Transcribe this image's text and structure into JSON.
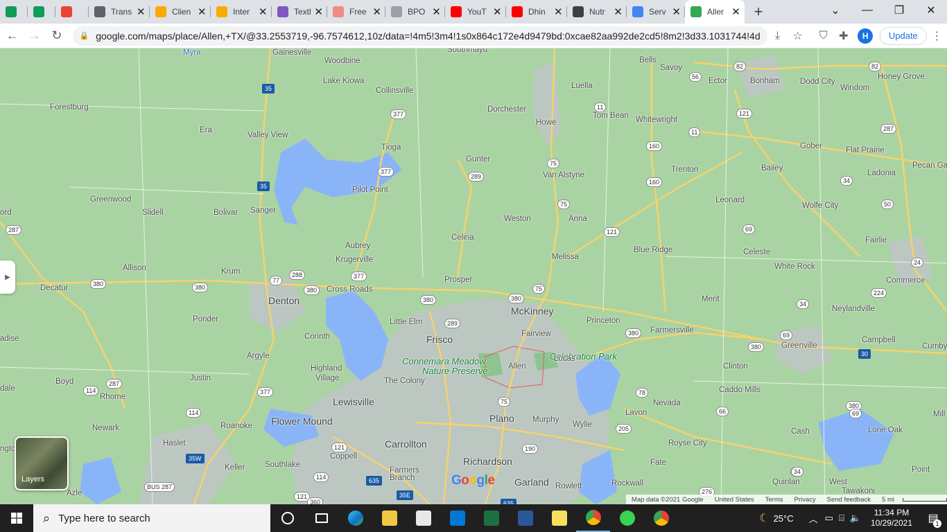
{
  "browser": {
    "tabs": [
      {
        "title": "",
        "icon": "sheets-icon",
        "color": "#0f9d58"
      },
      {
        "title": "",
        "icon": "sheets-icon",
        "color": "#0f9d58"
      },
      {
        "title": "",
        "icon": "gmail-icon",
        "color": "#ea4335"
      },
      {
        "title": "Trans",
        "icon": "globe-icon",
        "color": "#5f6368"
      },
      {
        "title": "Clien",
        "icon": "emoji-icon",
        "color": "#f9ab00"
      },
      {
        "title": "Inter",
        "icon": "emoji-icon",
        "color": "#f9ab00"
      },
      {
        "title": "Textl",
        "icon": "textnow-icon",
        "color": "#7e57c2"
      },
      {
        "title": "Free",
        "icon": "x-logo-icon",
        "color": "#f28b82"
      },
      {
        "title": "BPO",
        "icon": "page-icon",
        "color": "#9aa0a6"
      },
      {
        "title": "YouT",
        "icon": "youtube-icon",
        "color": "#ff0000"
      },
      {
        "title": "Dhin",
        "icon": "youtube-icon",
        "color": "#ff0000"
      },
      {
        "title": "Nutr",
        "icon": "cube-icon",
        "color": "#3c4043"
      },
      {
        "title": "Serv",
        "icon": "google-icon",
        "color": "#4285f4"
      },
      {
        "title": "Aller",
        "icon": "maps-pin-icon",
        "color": "#34a853",
        "active": true
      }
    ],
    "url": "google.com/maps/place/Allen,+TX/@33.2553719,-96.7574612,10z/data=!4m5!3m4!1s0x864c172e4d9479bd:0xcae82aa992de2cd5!8m2!3d33.1031744!4d-...",
    "profile_initial": "H",
    "update_label": "Update"
  },
  "map": {
    "places": [
      {
        "name": "Myra",
        "kind": "water"
      },
      {
        "name": "Gainesville",
        "kind": "town"
      },
      {
        "name": "Southmayd",
        "kind": "town"
      },
      {
        "name": "Woodbine",
        "kind": "town"
      },
      {
        "name": "Lake Kiowa",
        "kind": "town"
      },
      {
        "name": "Collinsville",
        "kind": "town"
      },
      {
        "name": "Forestburg",
        "kind": "town"
      },
      {
        "name": "Era",
        "kind": "town"
      },
      {
        "name": "Valley View",
        "kind": "town"
      },
      {
        "name": "Tioga",
        "kind": "town"
      },
      {
        "name": "Dorchester",
        "kind": "town"
      },
      {
        "name": "Howe",
        "kind": "town"
      },
      {
        "name": "Luella",
        "kind": "town"
      },
      {
        "name": "Bells",
        "kind": "town"
      },
      {
        "name": "Savoy",
        "kind": "town"
      },
      {
        "name": "Ector",
        "kind": "town"
      },
      {
        "name": "Bonham",
        "kind": "town"
      },
      {
        "name": "Dodd City",
        "kind": "town"
      },
      {
        "name": "Windom",
        "kind": "town"
      },
      {
        "name": "Honey Grove",
        "kind": "town"
      },
      {
        "name": "Tom Bean",
        "kind": "town"
      },
      {
        "name": "Whitewright",
        "kind": "town"
      },
      {
        "name": "Gober",
        "kind": "town"
      },
      {
        "name": "Flat Prairie",
        "kind": "town"
      },
      {
        "name": "Pecan Ga",
        "kind": "town"
      },
      {
        "name": "Gunter",
        "kind": "town"
      },
      {
        "name": "Van Alstyne",
        "kind": "town"
      },
      {
        "name": "Trenton",
        "kind": "town"
      },
      {
        "name": "Bailey",
        "kind": "town"
      },
      {
        "name": "Ladonia",
        "kind": "town"
      },
      {
        "name": "Greenwood",
        "kind": "town"
      },
      {
        "name": "Slidell",
        "kind": "town"
      },
      {
        "name": "Bolivar",
        "kind": "town"
      },
      {
        "name": "Sanger",
        "kind": "town"
      },
      {
        "name": "Pilot Point",
        "kind": "town"
      },
      {
        "name": "Leonard",
        "kind": "town"
      },
      {
        "name": "Wolfe City",
        "kind": "town"
      },
      {
        "name": "ord",
        "kind": "town"
      },
      {
        "name": "Weston",
        "kind": "town"
      },
      {
        "name": "Anna",
        "kind": "town"
      },
      {
        "name": "Celina",
        "kind": "town"
      },
      {
        "name": "Aubrey",
        "kind": "town"
      },
      {
        "name": "Krugerville",
        "kind": "town"
      },
      {
        "name": "Blue Ridge",
        "kind": "town"
      },
      {
        "name": "Celeste",
        "kind": "town"
      },
      {
        "name": "Fairlie",
        "kind": "town"
      },
      {
        "name": "Melissa",
        "kind": "town"
      },
      {
        "name": "Allison",
        "kind": "town"
      },
      {
        "name": "Krum",
        "kind": "town"
      },
      {
        "name": "White Rock",
        "kind": "town"
      },
      {
        "name": "Decatur",
        "kind": "town"
      },
      {
        "name": "Prosper",
        "kind": "town"
      },
      {
        "name": "Cross Roads",
        "kind": "town"
      },
      {
        "name": "Commerce",
        "kind": "town"
      },
      {
        "name": "Denton",
        "kind": "city"
      },
      {
        "name": "McKinney",
        "kind": "city"
      },
      {
        "name": "Merit",
        "kind": "town"
      },
      {
        "name": "Neylandville",
        "kind": "town"
      },
      {
        "name": "Ponder",
        "kind": "town"
      },
      {
        "name": "Little Elm",
        "kind": "town"
      },
      {
        "name": "Princeton",
        "kind": "town"
      },
      {
        "name": "Farmersville",
        "kind": "town"
      },
      {
        "name": "Fairview",
        "kind": "town"
      },
      {
        "name": "Greenville",
        "kind": "town"
      },
      {
        "name": "Frisco",
        "kind": "city"
      },
      {
        "name": "Corinth",
        "kind": "town"
      },
      {
        "name": "Campbell",
        "kind": "town"
      },
      {
        "name": "Cumby",
        "kind": "town"
      },
      {
        "name": "adise",
        "kind": "town"
      },
      {
        "name": "Argyle",
        "kind": "town"
      },
      {
        "name": "Celebration Park",
        "kind": "park"
      },
      {
        "name": "Connemara Meadow",
        "kind": "park"
      },
      {
        "name": "Nature Preserve",
        "kind": "park"
      },
      {
        "name": "Allen",
        "kind": "town"
      },
      {
        "name": "Highland",
        "kind": "town"
      },
      {
        "name": "Village",
        "kind": "town"
      },
      {
        "name": "Clinton",
        "kind": "town"
      },
      {
        "name": "Lucas",
        "kind": "town"
      },
      {
        "name": "Justin",
        "kind": "town"
      },
      {
        "name": "The Colony",
        "kind": "town"
      },
      {
        "name": "Boyd",
        "kind": "town"
      },
      {
        "name": "dale",
        "kind": "town"
      },
      {
        "name": "Rhome",
        "kind": "town"
      },
      {
        "name": "Caddo Mills",
        "kind": "town"
      },
      {
        "name": "Lewisville",
        "kind": "city"
      },
      {
        "name": "Nevada",
        "kind": "town"
      },
      {
        "name": "Lavon",
        "kind": "town"
      },
      {
        "name": "Plano",
        "kind": "city"
      },
      {
        "name": "Flower Mound",
        "kind": "city"
      },
      {
        "name": "Murphy",
        "kind": "town"
      },
      {
        "name": "Roanoke",
        "kind": "town"
      },
      {
        "name": "Wylie",
        "kind": "town"
      },
      {
        "name": "Newark",
        "kind": "town"
      },
      {
        "name": "Mill",
        "kind": "town"
      },
      {
        "name": "Haslet",
        "kind": "town"
      },
      {
        "name": "Carrollton",
        "kind": "city"
      },
      {
        "name": "Royse City",
        "kind": "town"
      },
      {
        "name": "Cash",
        "kind": "town"
      },
      {
        "name": "Lone Oak",
        "kind": "town"
      },
      {
        "name": "ngto",
        "kind": "town"
      },
      {
        "name": "Coppell",
        "kind": "town"
      },
      {
        "name": "Southlake",
        "kind": "town"
      },
      {
        "name": "Richardson",
        "kind": "city"
      },
      {
        "name": "Keller",
        "kind": "town"
      },
      {
        "name": "Fate",
        "kind": "town"
      },
      {
        "name": "Farmers",
        "kind": "town"
      },
      {
        "name": "Branch",
        "kind": "town"
      },
      {
        "name": "Point",
        "kind": "town"
      },
      {
        "name": "Garland",
        "kind": "city"
      },
      {
        "name": "Rockwall",
        "kind": "town"
      },
      {
        "name": "Quinlan",
        "kind": "town"
      },
      {
        "name": "West",
        "kind": "town"
      },
      {
        "name": "Tawakoni",
        "kind": "town"
      },
      {
        "name": "Azle",
        "kind": "town"
      },
      {
        "name": "Rowlett",
        "kind": "town"
      }
    ],
    "shields": [
      {
        "label": "35",
        "kind": "interstate"
      },
      {
        "label": "35",
        "kind": "interstate"
      },
      {
        "label": "377"
      },
      {
        "label": "377"
      },
      {
        "label": "377"
      },
      {
        "label": "377"
      },
      {
        "label": "289"
      },
      {
        "label": "289"
      },
      {
        "label": "75"
      },
      {
        "label": "75"
      },
      {
        "label": "75"
      },
      {
        "label": "75"
      },
      {
        "label": "11"
      },
      {
        "label": "11"
      },
      {
        "label": "160"
      },
      {
        "label": "160"
      },
      {
        "label": "82"
      },
      {
        "label": "82"
      },
      {
        "label": "56"
      },
      {
        "label": "121"
      },
      {
        "label": "121"
      },
      {
        "label": "121"
      },
      {
        "label": "121"
      },
      {
        "label": "34"
      },
      {
        "label": "34"
      },
      {
        "label": "34"
      },
      {
        "label": "50"
      },
      {
        "label": "69"
      },
      {
        "label": "69"
      },
      {
        "label": "24"
      },
      {
        "label": "224"
      },
      {
        "label": "287"
      },
      {
        "label": "287"
      },
      {
        "label": "287"
      },
      {
        "label": "380"
      },
      {
        "label": "380"
      },
      {
        "label": "380"
      },
      {
        "label": "380"
      },
      {
        "label": "380"
      },
      {
        "label": "380"
      },
      {
        "label": "380"
      },
      {
        "label": "380"
      },
      {
        "label": "77"
      },
      {
        "label": "288"
      },
      {
        "label": "30",
        "kind": "interstate"
      },
      {
        "label": "114"
      },
      {
        "label": "114"
      },
      {
        "label": "114"
      },
      {
        "label": "78"
      },
      {
        "label": "66"
      },
      {
        "label": "66"
      },
      {
        "label": "69"
      },
      {
        "label": "205"
      },
      {
        "label": "190"
      },
      {
        "label": "35W",
        "kind": "interstate"
      },
      {
        "label": "635",
        "kind": "interstate"
      },
      {
        "label": "635",
        "kind": "interstate"
      },
      {
        "label": "35E",
        "kind": "interstate"
      },
      {
        "label": "276"
      },
      {
        "label": "BUS 287"
      },
      {
        "label": "360"
      },
      {
        "label": "34"
      }
    ],
    "side_panel_toggle_icon": "chevron-right-icon",
    "layers_label": "Layers",
    "google_logo": [
      "G",
      "o",
      "o",
      "g",
      "l",
      "e"
    ],
    "google_logo_colors": [
      "#4285f4",
      "#ea4335",
      "#fbbc05",
      "#4285f4",
      "#34a853",
      "#ea4335"
    ],
    "footer": {
      "map_data": "Map data ©2021 Google",
      "region": "United States",
      "terms": "Terms",
      "privacy": "Privacy",
      "feedback": "Send feedback",
      "scale": "5 mi"
    }
  },
  "taskbar": {
    "search_placeholder": "Type here to search",
    "apps": [
      {
        "name": "cortana-icon",
        "color": "#ffffff"
      },
      {
        "name": "task-view-icon",
        "color": "#ffffff"
      },
      {
        "name": "edge-icon",
        "color": "#0f8ac4"
      },
      {
        "name": "file-explorer-icon",
        "color": "#f2c744"
      },
      {
        "name": "microsoft-store-icon",
        "color": "#e8e8e8"
      },
      {
        "name": "mail-icon",
        "color": "#0078d4"
      },
      {
        "name": "excel-icon",
        "color": "#1d6f42"
      },
      {
        "name": "word-icon",
        "color": "#2b579a"
      },
      {
        "name": "sticky-notes-icon",
        "color": "#f6e05e"
      },
      {
        "name": "chrome-icon",
        "color": "#4285f4",
        "active": true
      },
      {
        "name": "flower-app-icon",
        "color": "#39d353"
      },
      {
        "name": "chrome-icon",
        "color": "#4285f4"
      }
    ],
    "weather": "25°C",
    "time": "11:34 PM",
    "date": "10/29/2021",
    "notification_count": "1"
  }
}
